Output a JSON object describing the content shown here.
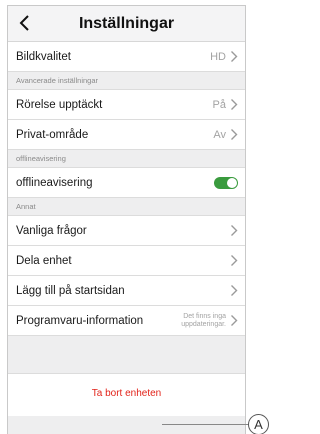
{
  "header": {
    "title": "Inställningar",
    "back_icon": "chevron-left-icon"
  },
  "rows": {
    "bildkvalitet": {
      "label": "Bildkvalitet",
      "value": "HD"
    },
    "rorelse": {
      "label": "Rörelse upptäckt",
      "value": "På"
    },
    "privat": {
      "label": "Privat-område",
      "value": "Av"
    },
    "offline": {
      "label": "offlineavisering",
      "toggle_on": true
    },
    "faq": {
      "label": "Vanliga frågor"
    },
    "dela": {
      "label": "Dela enhet"
    },
    "startsida": {
      "label": "Lägg till på startsidan"
    },
    "programvara": {
      "label": "Programvaru-information",
      "value": "Det finns inga uppdateringar."
    }
  },
  "sections": {
    "avancerade": "Avancerade inställningar",
    "offline": "offlineavisering",
    "annat": "Annat"
  },
  "footer": {
    "remove_label": "Ta bort enheten"
  },
  "callout": {
    "label": "A"
  },
  "colors": {
    "toggle_on": "#3a9b3e",
    "danger": "#e2231a",
    "muted": "#a3a3a3"
  }
}
